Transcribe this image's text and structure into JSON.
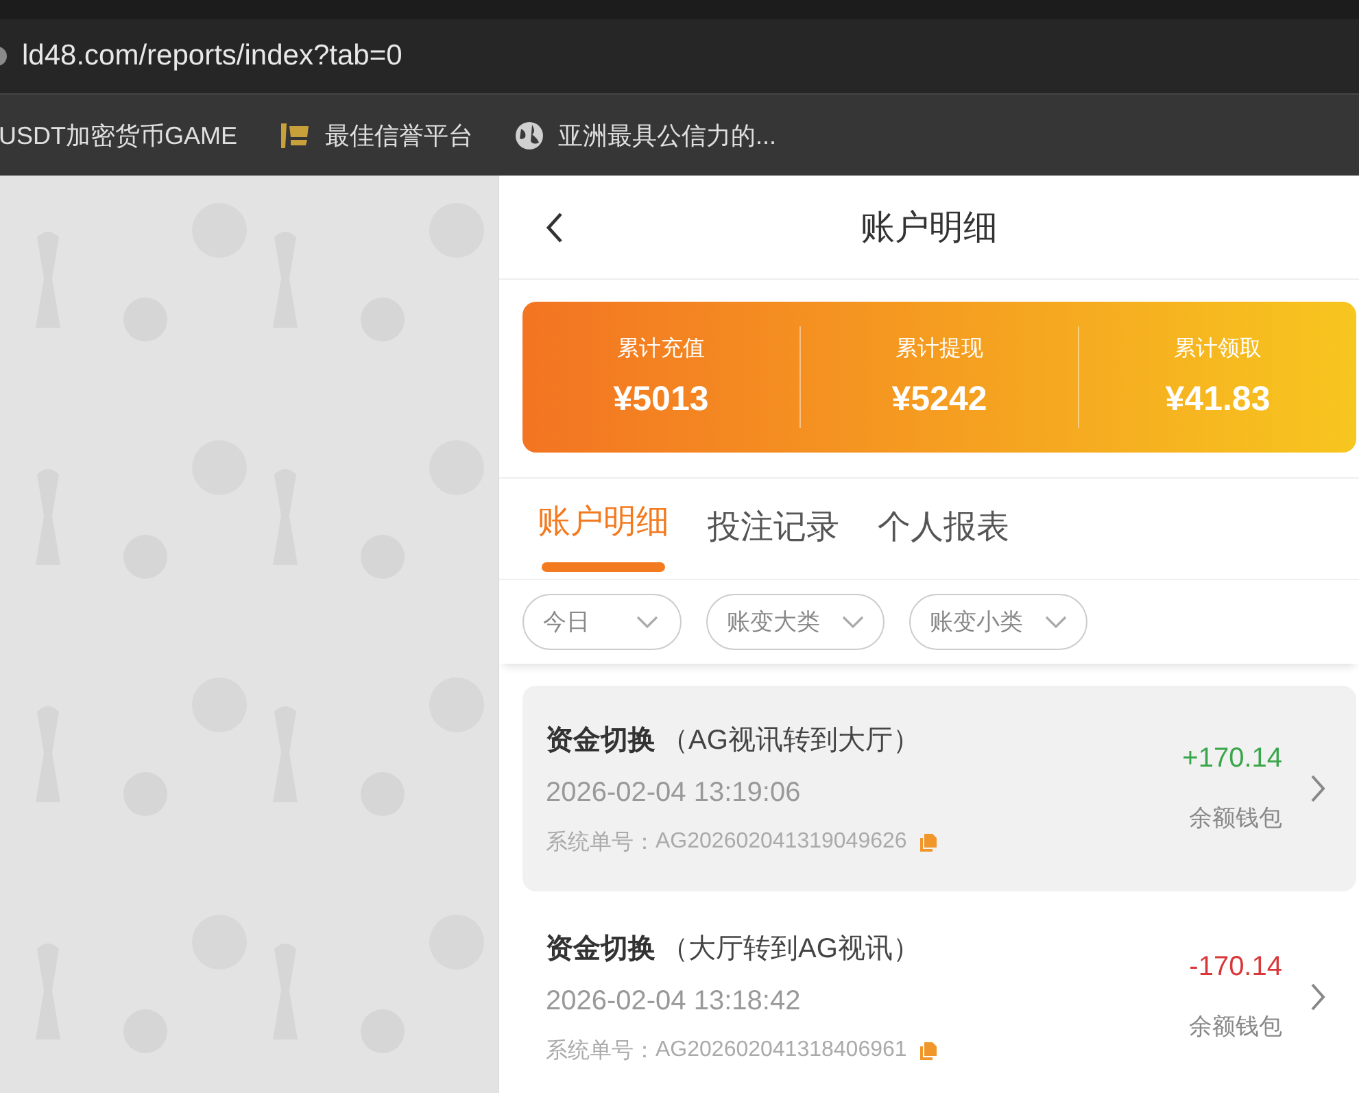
{
  "browser": {
    "url": "ld48.com/reports/index?tab=0",
    "bookmarks": [
      {
        "kind": "none",
        "label": "USDT加密货币GAME"
      },
      {
        "kind": "logo",
        "label": "最佳信誉平台"
      },
      {
        "kind": "globe",
        "label": "亚洲最具公信力的..."
      }
    ]
  },
  "header": {
    "title": "账户明细"
  },
  "summary": [
    {
      "label": "累计充值",
      "value": "¥5013"
    },
    {
      "label": "累计提现",
      "value": "¥5242"
    },
    {
      "label": "累计领取",
      "value": "¥41.83"
    }
  ],
  "tabs": [
    {
      "label": "账户明细",
      "selected": true
    },
    {
      "label": "投注记录",
      "selected": false
    },
    {
      "label": "个人报表",
      "selected": false
    }
  ],
  "filters": [
    {
      "label": "今日"
    },
    {
      "label": "账变大类"
    },
    {
      "label": "账变小类"
    }
  ],
  "records": [
    {
      "title": "资金切换",
      "detail": "（AG视讯转到大厅）",
      "time": "2026-02-04 13:19:06",
      "order_label": "系统单号：",
      "order_no": "AG202602041319049626",
      "amount": "+170.14",
      "color": "#3aa64a",
      "wallet": "余额钱包",
      "selected": true
    },
    {
      "title": "资金切换",
      "detail": "（大厅转到AG视讯）",
      "time": "2026-02-04 13:18:42",
      "order_label": "系统单号：",
      "order_no": "AG202602041318406961",
      "amount": "-170.14",
      "color": "#d9383a",
      "wallet": "余额钱包",
      "selected": false
    }
  ]
}
